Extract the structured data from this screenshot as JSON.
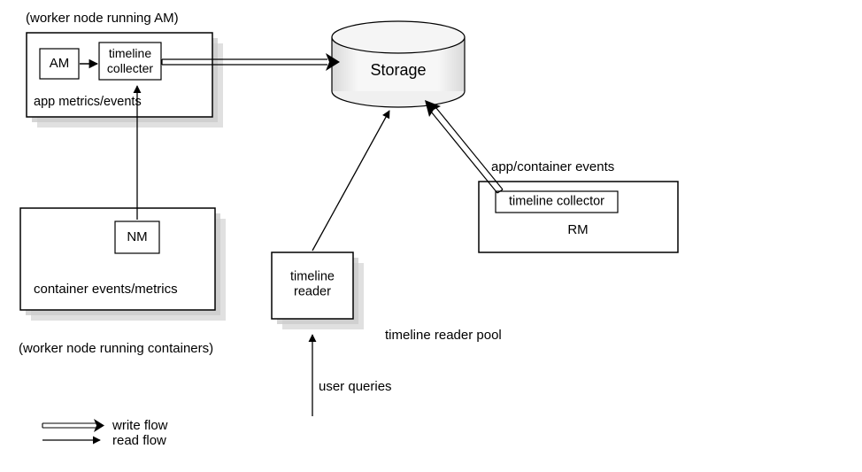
{
  "nodes": {
    "workerAM": {
      "title": "(worker node running AM)",
      "am": "AM",
      "collector": "timeline\ncollecter",
      "caption": "app metrics/events"
    },
    "storage": {
      "label": "Storage"
    },
    "rm": {
      "collector": "timeline collector",
      "label": "RM",
      "edgeLabel": "app/container events"
    },
    "workerNM": {
      "nm": "NM",
      "caption": "container events/metrics",
      "title": "(worker node running containers)"
    },
    "reader": {
      "label": "timeline\nreader",
      "poolLabel": "timeline reader pool",
      "queryLabel": "user queries"
    }
  },
  "legend": {
    "write": "write flow",
    "read": "read flow"
  }
}
